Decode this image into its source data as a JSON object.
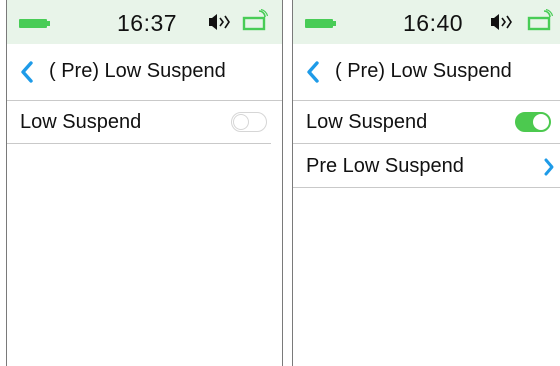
{
  "colors": {
    "accent_blue": "#1e9be8",
    "toggle_on": "#4cc94f",
    "battery_green": "#48cc56",
    "status_bar_bg": "#e8f4e9"
  },
  "screens": [
    {
      "status": {
        "time": "16:37",
        "icons": [
          "battery-icon",
          "sound-icon",
          "signal-icon"
        ]
      },
      "nav": {
        "title": "( Pre) Low Suspend",
        "back_icon": "chevron-left-icon"
      },
      "rows": [
        {
          "label": "Low Suspend",
          "control": "toggle",
          "enabled": false
        }
      ]
    },
    {
      "status": {
        "time": "16:40",
        "icons": [
          "battery-icon",
          "sound-icon",
          "signal-icon"
        ]
      },
      "nav": {
        "title": "( Pre) Low Suspend",
        "back_icon": "chevron-left-icon"
      },
      "rows": [
        {
          "label": "Low Suspend",
          "control": "toggle",
          "enabled": true
        },
        {
          "label": "Pre Low Suspend",
          "control": "chevron",
          "icon": "chevron-right-icon"
        }
      ]
    }
  ]
}
